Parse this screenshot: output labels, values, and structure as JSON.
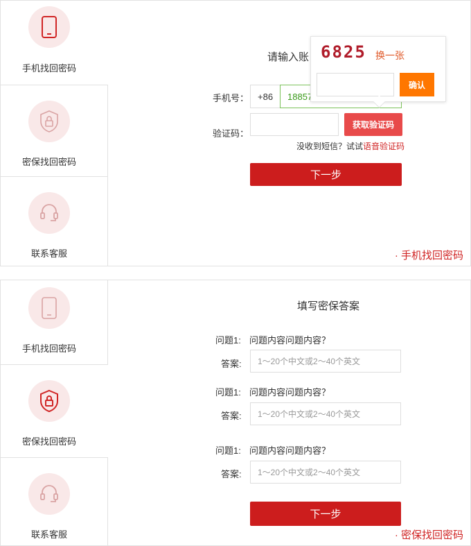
{
  "colors": {
    "accent": "#cc1d1d",
    "light_red": "#f9e8e8",
    "orange": "#ff7700"
  },
  "panel1": {
    "sidebar": [
      {
        "label": "手机找回密码",
        "icon": "phone-icon",
        "active": true
      },
      {
        "label": "密保找回密码",
        "icon": "shield-lock-icon",
        "active": false
      },
      {
        "label": "联系客服",
        "icon": "headset-icon",
        "active": false
      }
    ],
    "title": "请输入账",
    "phone_label": "手机号：",
    "country_code": "+86",
    "phone_value": "188578",
    "code_label": "验证码：",
    "code_value": "",
    "get_code_button": "获取验证码",
    "no_sms_text": "没收到短信？试试",
    "voice_code_link": "语音验证码",
    "next_button": "下一步",
    "captcha_popup": {
      "captcha_text": "6825",
      "refresh_link": "换一张",
      "input_value": "",
      "confirm_button": "确认"
    },
    "caption": "· 手机找回密码"
  },
  "panel2": {
    "sidebar": [
      {
        "label": "手机找回密码",
        "icon": "phone-icon",
        "active": false
      },
      {
        "label": "密保找回密码",
        "icon": "shield-lock-icon",
        "active": true
      },
      {
        "label": "联系客服",
        "icon": "headset-icon",
        "active": false
      }
    ],
    "title": "填写密保答案",
    "questions": [
      {
        "q_label": "问题1:",
        "question": "问题内容问题内容？",
        "a_label": "答案:",
        "placeholder": "1～20个中文或2～40个英文"
      },
      {
        "q_label": "问题1:",
        "question": "问题内容问题内容？",
        "a_label": "答案:",
        "placeholder": "1～20个中文或2～40个英文"
      },
      {
        "q_label": "问题1:",
        "question": "问题内容问题内容？",
        "a_label": "答案:",
        "placeholder": "1～20个中文或2～40个英文"
      }
    ],
    "next_button": "下一步",
    "caption": "· 密保找回密码"
  }
}
